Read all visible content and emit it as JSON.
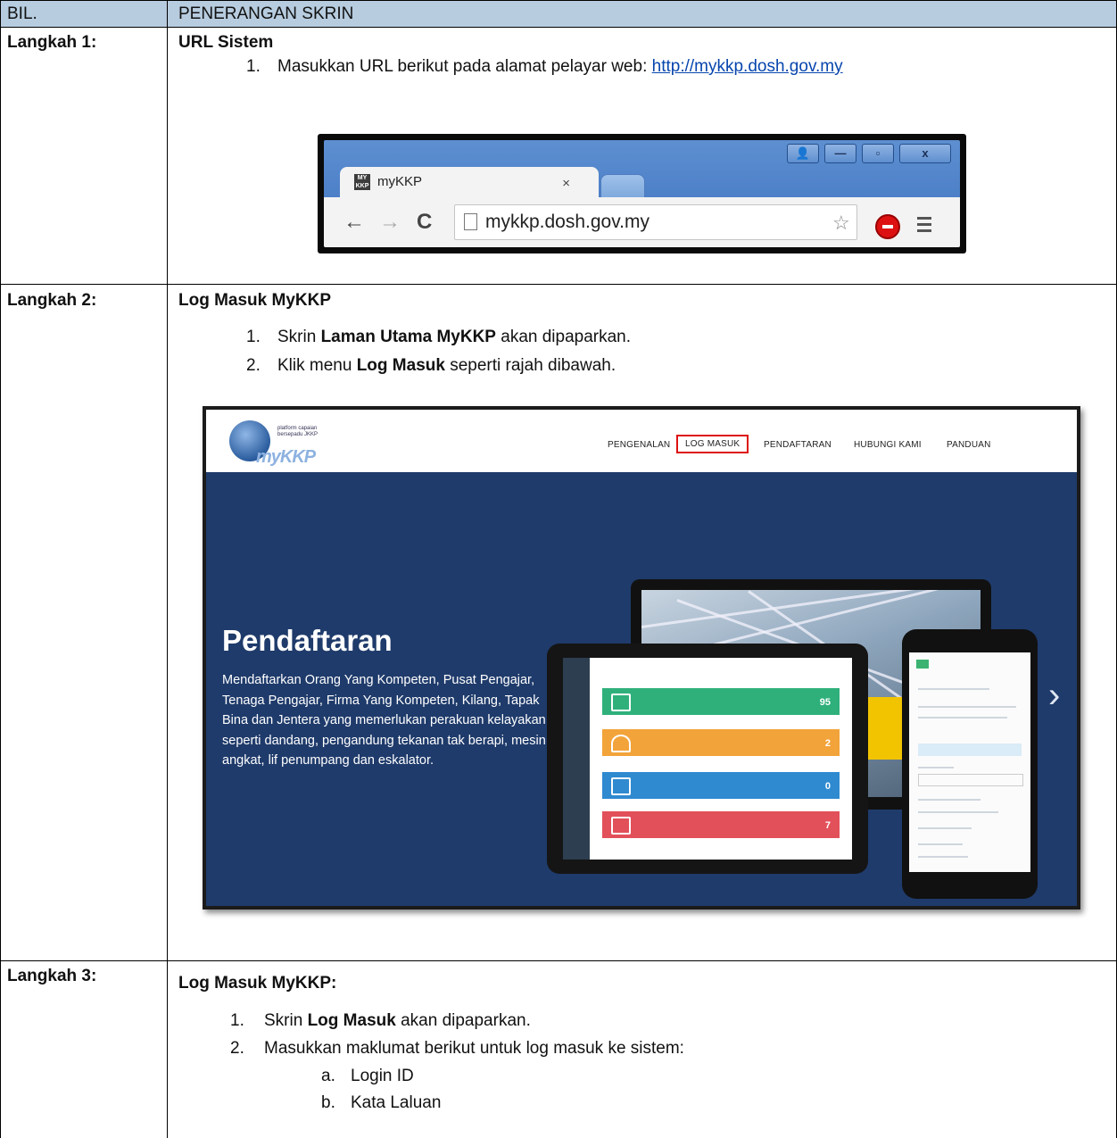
{
  "table": {
    "header": {
      "col1": "BIL.",
      "col2": "PENERANGAN SKRIN"
    },
    "step1": {
      "label": "Langkah 1:",
      "title": "URL Sistem",
      "item1_num": "1.",
      "item1_text": "Masukkan URL berikut pada alamat pelayar web: ",
      "item1_link": "http://mykkp.dosh.gov.my"
    },
    "step2": {
      "label": "Langkah 2:",
      "title": "Log Masuk MyKKP",
      "item1_num": "1.",
      "item1_pre": "Skrin ",
      "item1_bold": "Laman Utama MyKKP",
      "item1_post": " akan dipaparkan.",
      "item2_num": "2.",
      "item2_pre": "Klik menu ",
      "item2_bold": "Log Masuk",
      "item2_post": " seperti rajah dibawah."
    },
    "step3": {
      "label": "Langkah 3:",
      "title": "Log Masuk MyKKP:",
      "item1_num": "1.",
      "item1_pre": "Skrin ",
      "item1_bold": "Log Masuk",
      "item1_post": " akan dipaparkan.",
      "item2_num": "2.",
      "item2_text": "Masukkan maklumat berikut untuk log masuk ke sistem:",
      "sub_a_num": "a.",
      "sub_a_text": "Login ID",
      "sub_b_num": "b.",
      "sub_b_text": "Kata Laluan"
    }
  },
  "browser_mock": {
    "tab_title": "myKKP",
    "tab_logo": "MY KKP",
    "tab_close": "×",
    "address": "mykkp.dosh.gov.my",
    "back": "←",
    "forward": "→",
    "reload": "C",
    "star": "☆",
    "win_user": "👤",
    "win_min": "—",
    "win_max": "▫",
    "win_close": "x"
  },
  "site_mock": {
    "logo_text": "myKKP",
    "logo_tagline": "platform capaian bersepadu JKKP",
    "nav": [
      "PENGENALAN",
      "LOG MASUK",
      "PENDAFTARAN",
      "HUBUNGI KAMI",
      "PANDUAN"
    ],
    "hero_title": "Pendaftaran",
    "hero_desc": "Mendaftarkan Orang Yang Kompeten, Pusat Pengajar, Tenaga Pengajar, Firma Yang Kompeten, Kilang, Tapak Bina dan Jentera yang memerlukan perakuan kelayakan seperti dandang, pengandung tekanan tak berapi, mesin angkat, lif penumpang dan eskalator.",
    "next": "›",
    "tablet_numbers": [
      "95",
      "2",
      "0",
      "7"
    ],
    "colors": {
      "hero_bg": "#1f3b6b",
      "active_border": "#dd1111"
    }
  }
}
